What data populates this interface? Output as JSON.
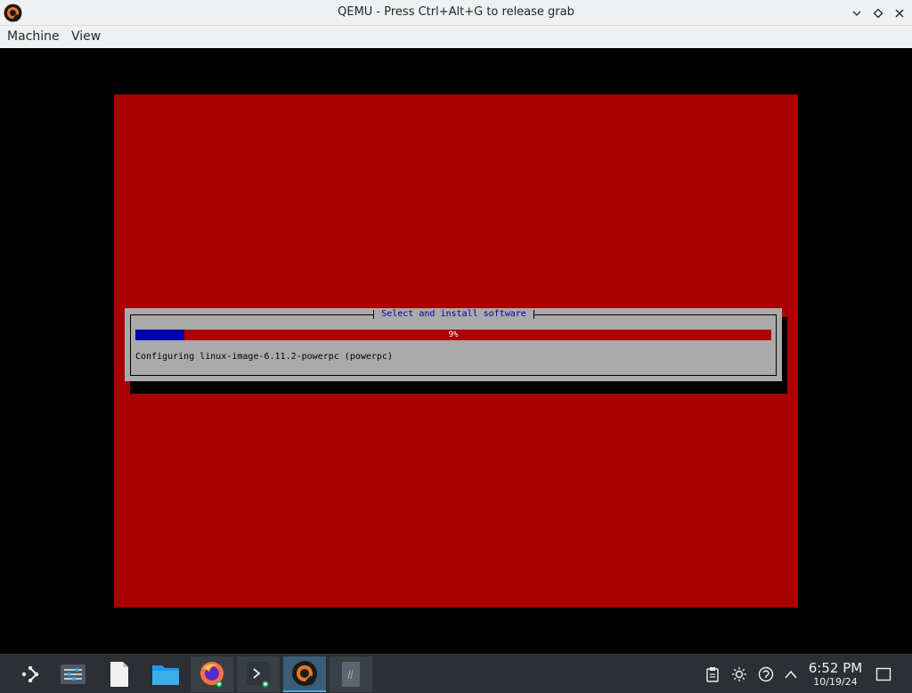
{
  "window": {
    "title": "QEMU - Press Ctrl+Alt+G to release grab",
    "app_icon": "qemu-icon",
    "controls": [
      "minimize-icon",
      "maximize-icon",
      "close-icon"
    ]
  },
  "menubar": {
    "items": [
      "Machine",
      "View"
    ]
  },
  "installer": {
    "dialog_title": "Select and install software",
    "progress_percent": 9,
    "progress_label": "9%",
    "status": "Configuring linux-image-6.11.2-powerpc (powerpc)",
    "colors": {
      "background": "#aa0000",
      "dialog": "#aaaaaa",
      "progress_fill": "#0000aa",
      "title_text": "#0000aa"
    }
  },
  "taskbar": {
    "launchers": [
      "app-launcher-icon",
      "system-settings-icon",
      "text-file-icon",
      "file-manager-icon",
      "firefox-icon",
      "terminal-icon",
      "qemu-icon",
      "document-viewer-icon"
    ],
    "tray": [
      "clipboard-icon",
      "brightness-icon",
      "network-icon",
      "expand-tray-icon"
    ],
    "clock": {
      "time": "6:52 PM",
      "date": "10/19/24"
    },
    "show_desktop": "show-desktop-icon"
  }
}
